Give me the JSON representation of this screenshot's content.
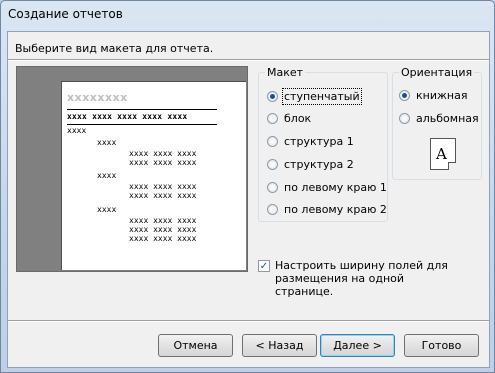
{
  "window": {
    "title": "Создание отчетов"
  },
  "prompt": "Выберите вид макета для отчета.",
  "preview": {
    "title": "xxxxxxxx",
    "header_row": "xxxx xxxx xxxx xxxx xxxx",
    "group1": "xxxx",
    "group2": "xxxx",
    "group3": "xxxx",
    "group4": "xxxx",
    "detail": "xxxx xxxx xxxx"
  },
  "layout": {
    "legend": "Макет",
    "options": [
      {
        "label": "ступенчатый",
        "selected": true
      },
      {
        "label": "блок",
        "selected": false
      },
      {
        "label": "структура 1",
        "selected": false
      },
      {
        "label": "структура 2",
        "selected": false
      },
      {
        "label": "по левому краю 1",
        "selected": false
      },
      {
        "label": "по левому краю 2",
        "selected": false
      }
    ]
  },
  "orientation": {
    "legend": "Ориентация",
    "options": [
      {
        "label": "книжная",
        "selected": true
      },
      {
        "label": "альбомная",
        "selected": false
      }
    ],
    "icon_letter": "A"
  },
  "fit_width": {
    "checked": true,
    "label": "Настроить ширину полей для размещения на одной странице."
  },
  "buttons": {
    "cancel": "Отмена",
    "back": "< Назад",
    "next": "Далее >",
    "finish": "Готово"
  }
}
